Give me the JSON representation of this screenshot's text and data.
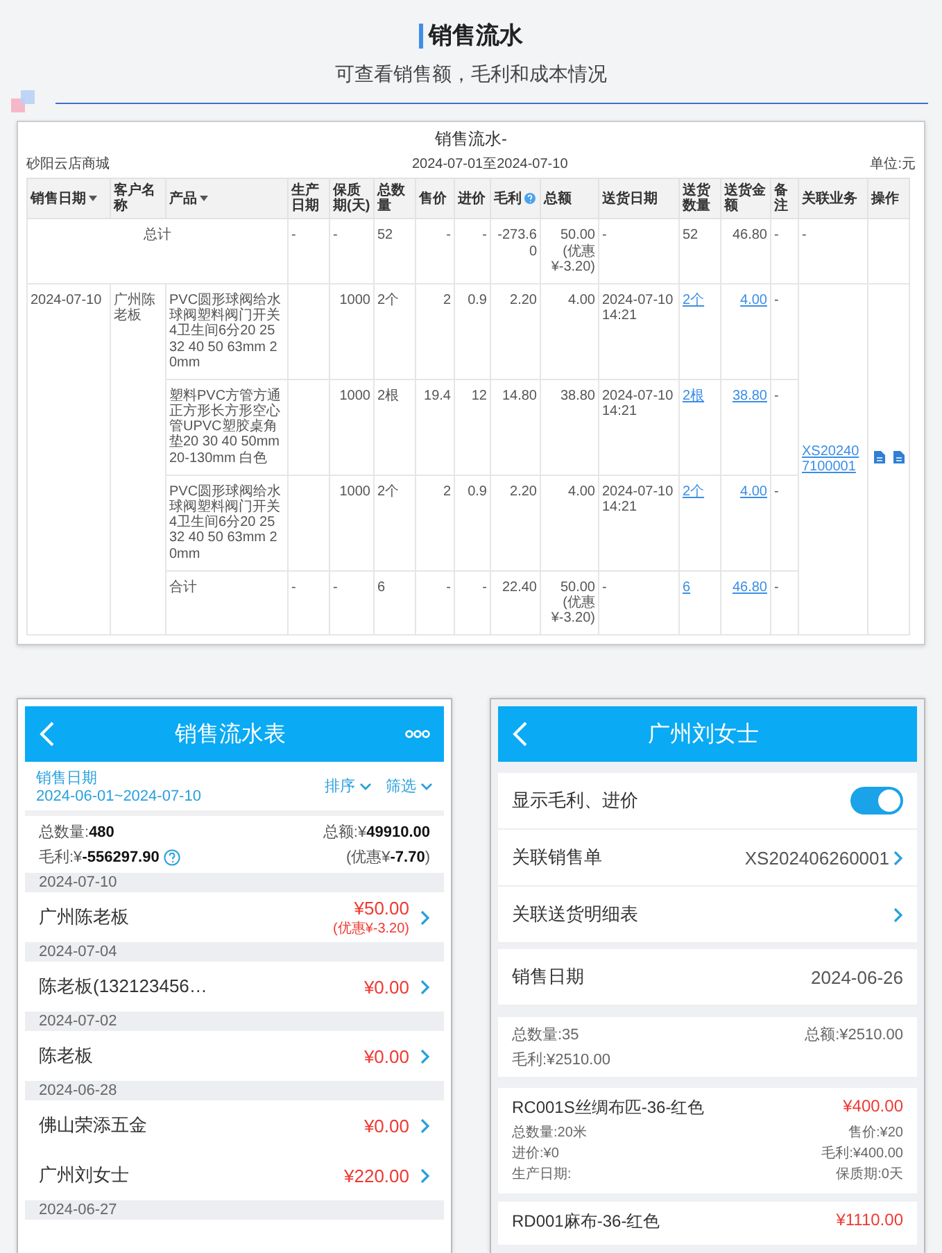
{
  "header": {
    "title": "销售流水",
    "subtitle": "可查看销售额，毛利和成本情况"
  },
  "report": {
    "title": "销售流水-",
    "shop": "砂阳云店商城",
    "date_range": "2024-07-01至2024-07-10",
    "unit": "单位:元",
    "columns": [
      {
        "label": "销售日期",
        "sortable": true,
        "help": false
      },
      {
        "label": "客户名称",
        "sortable": false,
        "help": false
      },
      {
        "label": "产品",
        "sortable": true,
        "help": false
      },
      {
        "label": "生产日期",
        "sortable": false,
        "help": false
      },
      {
        "label": "保质期(天)",
        "sortable": false,
        "help": false
      },
      {
        "label": "总数量",
        "sortable": false,
        "help": false
      },
      {
        "label": "售价",
        "sortable": false,
        "help": false
      },
      {
        "label": "进价",
        "sortable": false,
        "help": false
      },
      {
        "label": "毛利",
        "sortable": false,
        "help": true
      },
      {
        "label": "总额",
        "sortable": false,
        "help": false
      },
      {
        "label": "送货日期",
        "sortable": false,
        "help": false
      },
      {
        "label": "送货数量",
        "sortable": false,
        "help": false
      },
      {
        "label": "送货金额",
        "sortable": false,
        "help": false
      },
      {
        "label": "备注",
        "sortable": false,
        "help": false
      },
      {
        "label": "关联业务",
        "sortable": false,
        "help": false
      },
      {
        "label": "操作",
        "sortable": false,
        "help": false
      }
    ],
    "total": {
      "label": "总计",
      "production_date": "-",
      "shelf_life": "-",
      "quantity": "52",
      "price": "-",
      "cost": "-",
      "profit": "-273.60",
      "amount": "50.00",
      "discount": "(优惠¥-3.20)",
      "delivery_date": "-",
      "delivery_qty": "52",
      "delivery_amount": "46.80",
      "remark": "-",
      "linked": "-"
    },
    "groups": [
      {
        "date": "2024-07-10",
        "customer": "广州陈老板",
        "linked": "XS202407100001",
        "items": [
          {
            "product": "PVC圆形球阀给水球阀塑料阀门开关4卫生间6分20 25 32 40 50 63mm 20mm",
            "shelf_life": "1000",
            "quantity": "2个",
            "price": "2",
            "cost": "0.9",
            "profit": "2.20",
            "amount": "4.00",
            "delivery_date": "2024-07-10 14:21",
            "delivery_qty": "2个",
            "delivery_amount": "4.00",
            "remark": "-"
          },
          {
            "product": "塑料PVC方管方通正方形长方形空心管UPVC塑胶桌角垫20 30 40 50mm 20-130mm 白色",
            "shelf_life": "1000",
            "quantity": "2根",
            "price": "19.4",
            "cost": "12",
            "profit": "14.80",
            "amount": "38.80",
            "delivery_date": "2024-07-10 14:21",
            "delivery_qty": "2根",
            "delivery_amount": "38.80",
            "remark": "-"
          },
          {
            "product": "PVC圆形球阀给水球阀塑料阀门开关4卫生间6分20 25 32 40 50 63mm 20mm",
            "shelf_life": "1000",
            "quantity": "2个",
            "price": "2",
            "cost": "0.9",
            "profit": "2.20",
            "amount": "4.00",
            "delivery_date": "2024-07-10 14:21",
            "delivery_qty": "2个",
            "delivery_amount": "4.00",
            "remark": "-"
          }
        ],
        "subtotal": {
          "label": "合计",
          "production_date": "-",
          "shelf_life": "-",
          "quantity": "6",
          "price": "-",
          "cost": "-",
          "profit": "22.40",
          "amount": "50.00",
          "discount": "(优惠¥-3.20)",
          "delivery_date": "-",
          "delivery_qty": "6",
          "delivery_amount": "46.80",
          "remark": "-"
        }
      }
    ]
  },
  "list_screen": {
    "title": "销售流水表",
    "date_label": "销售日期",
    "date_range": "2024-06-01~2024-07-10",
    "sort": "排序",
    "filter": "筛选",
    "total_qty": "总数量:**480**",
    "total_amount": "总额:¥**49910.00**",
    "profit": "毛利:¥**-556297.90**",
    "discount": "(优惠¥**-7.70**)",
    "groups": [
      {
        "date": "2024-07-10",
        "entries": [
          {
            "name": "广州陈老板",
            "amount": "¥50.00",
            "discount": "(优惠¥-3.20)"
          }
        ]
      },
      {
        "date": "2024-07-04",
        "entries": [
          {
            "name": "陈老板(132123456…",
            "amount": "¥0.00"
          }
        ]
      },
      {
        "date": "2024-07-02",
        "entries": [
          {
            "name": "陈老板",
            "amount": "¥0.00"
          }
        ]
      },
      {
        "date": "2024-06-28",
        "entries": [
          {
            "name": "佛山荣添五金",
            "amount": "¥0.00"
          },
          {
            "name": "广州刘女士",
            "amount": "¥220.00"
          }
        ]
      },
      {
        "date": "2024-06-27"
      }
    ]
  },
  "detail_screen": {
    "title": "广州刘女士",
    "show_profit": {
      "label": "显示毛利、进价",
      "on": true
    },
    "rows": [
      {
        "label": "关联销售单",
        "value": "XS202406260001",
        "link": true
      },
      {
        "label": "关联送货明细表",
        "link": true
      },
      {
        "label": "销售日期",
        "value": "2024-06-26",
        "link": false
      }
    ],
    "summary": {
      "total_qty": "总数量:35",
      "total_amount": "总额:¥2510.00",
      "profit": "毛利:¥2510.00"
    },
    "items": [
      {
        "name": "RC001S丝绸布匹-36-红色",
        "amount": "¥400.00",
        "lines": [
          [
            "总数量:20米",
            "售价:¥20"
          ],
          [
            "进价:¥0",
            "毛利:¥400.00"
          ],
          [
            "生产日期:",
            "保质期:0天"
          ]
        ]
      },
      {
        "name": "RD001麻布-36-红色",
        "amount": "¥1110.00"
      }
    ]
  }
}
